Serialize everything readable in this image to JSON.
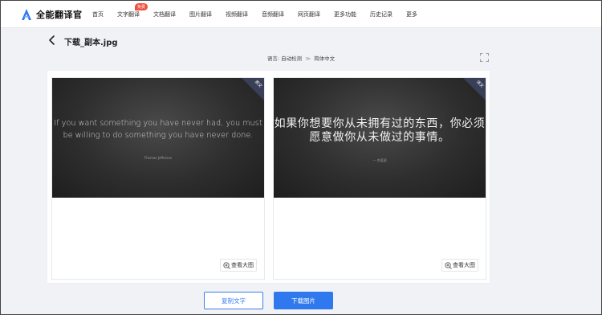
{
  "app": {
    "name": "全能翻译官",
    "brand_color": "#2f78ee"
  },
  "nav": {
    "items": [
      {
        "label": "首页"
      },
      {
        "label": "文字翻译",
        "badge": "免费"
      },
      {
        "label": "文档翻译"
      },
      {
        "label": "图片翻译"
      },
      {
        "label": "视频翻译"
      },
      {
        "label": "音频翻译"
      },
      {
        "label": "网页翻译"
      },
      {
        "label": "更多功能"
      },
      {
        "label": "历史记录"
      },
      {
        "label": "更多"
      }
    ]
  },
  "page": {
    "file_title": "下载_副本.jpg",
    "lang_label": "语言:",
    "source_lang": "自动检测",
    "separator": "≫",
    "target_lang": "简体中文"
  },
  "original_card": {
    "corner_label": "原文",
    "quote": "If you want something you have never had, you must be willing to do something you have never done.",
    "author": "Thomas Jefferson",
    "zoom_label": "查看大图"
  },
  "translated_card": {
    "corner_label": "译文",
    "quote": "如果你想要你从未拥有过的东西，你必须愿意做你从未做过的事情。",
    "author": "一 杰斐逊",
    "zoom_label": "查看大图"
  },
  "actions": {
    "copy_text": "复制文字",
    "download_image": "下载图片"
  }
}
